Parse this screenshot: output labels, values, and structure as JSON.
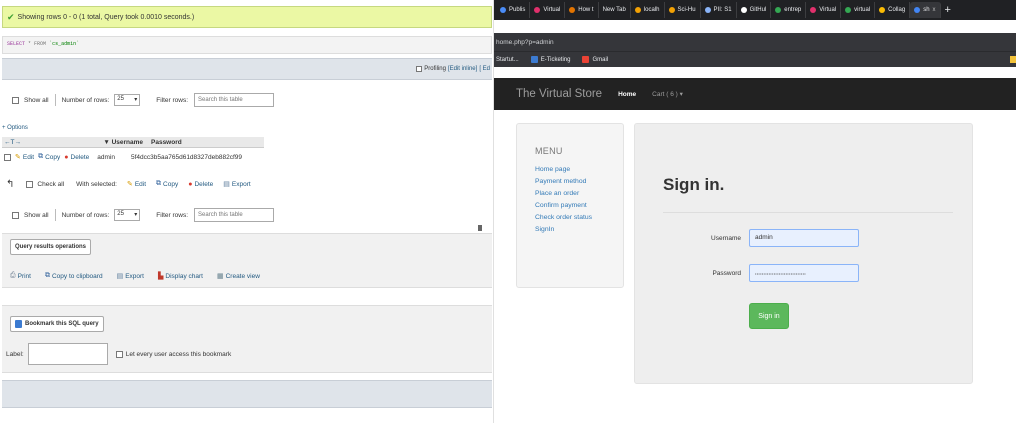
{
  "pma": {
    "success_message": "Showing rows 0 - 0 (1 total, Query took 0.0010 seconds.)",
    "sql_query": {
      "keyword": "SELECT",
      "from": "* FROM",
      "table": "`cs_admin`"
    },
    "profiling": {
      "label": "Profiling",
      "edit_inline": "[Edit inline]",
      "edit": "[ Ed"
    },
    "nav_top": {
      "show_all": "Show all",
      "num_rows_label": "Number of rows:",
      "num_rows_value": "25",
      "filter_label": "Filter rows:",
      "search_placeholder": "Search this table"
    },
    "options_label": "+ Options",
    "table": {
      "arrows": "←T→",
      "sort_arrow": "▼",
      "columns": [
        "Username",
        "Password"
      ],
      "row": {
        "edit": "Edit",
        "copy": "Copy",
        "delete": "Delete",
        "username": "admin",
        "password": "5f4dcc3b5aa765d61d8327deb882cf99"
      }
    },
    "with_selected": {
      "check_all": "Check all",
      "with_selected": "With selected:",
      "edit": "Edit",
      "copy": "Copy",
      "delete": "Delete",
      "export": "Export"
    },
    "nav_bottom": {
      "show_all": "Show all",
      "num_rows_label": "Number of rows:",
      "num_rows_value": "25",
      "filter_label": "Filter rows:",
      "search_placeholder": "Search this table"
    },
    "query_results": {
      "legend": "Query results operations",
      "print": "Print",
      "copy_clipboard": "Copy to clipboard",
      "export": "Export",
      "display_chart": "Display chart",
      "create_view": "Create view"
    },
    "bookmark": {
      "legend": "Bookmark this SQL query",
      "label": "Label:",
      "let_every_user": "Let every user access this bookmark"
    }
  },
  "browser": {
    "tabs": [
      {
        "label": "Publis",
        "color": "#4a8cf7"
      },
      {
        "label": "Virtual",
        "color": "#e1306c"
      },
      {
        "label": "How t",
        "color": "#e37400"
      },
      {
        "label": "New Tab",
        "color": ""
      },
      {
        "label": "localh",
        "color": "#f2a104"
      },
      {
        "label": "Sci-Hu",
        "color": "#f2a104"
      },
      {
        "label": "PII: S1",
        "color": "#8ab4f8"
      },
      {
        "label": "GitHul",
        "color": "#ffffff"
      },
      {
        "label": "entrep",
        "color": "#34a853"
      },
      {
        "label": "Virtual",
        "color": "#e1306c"
      },
      {
        "label": "virtual",
        "color": "#34a853"
      },
      {
        "label": "Collag",
        "color": "#fbbc04"
      },
      {
        "label": "sh",
        "color": "#4285f4",
        "active": true
      }
    ],
    "tab_close": "x",
    "new_tab": "+",
    "address": "home.php?p=admin",
    "bookmarks": [
      {
        "label": "Startut...",
        "color": ""
      },
      {
        "label": "E-Ticketing",
        "color": "#3c7bd1"
      },
      {
        "label": "Gmail",
        "color": "#ea4335"
      }
    ],
    "site": {
      "brand": "The Virtual Store",
      "nav": [
        {
          "label": "Home",
          "active": true
        },
        {
          "label": "Cart ( 6 ) ▾",
          "active": false
        }
      ],
      "menu": {
        "title": "MENU",
        "items": [
          "Home page",
          "Payment method",
          "Place an order",
          "Confirm payment",
          "Check order status",
          "SignIn"
        ]
      },
      "signin": {
        "title": "Sign in.",
        "username_label": "Username",
        "username_value": "admin",
        "password_label": "Password",
        "password_value": "••••••••••••••••••••••••••••••",
        "button": "Sign in"
      }
    }
  }
}
